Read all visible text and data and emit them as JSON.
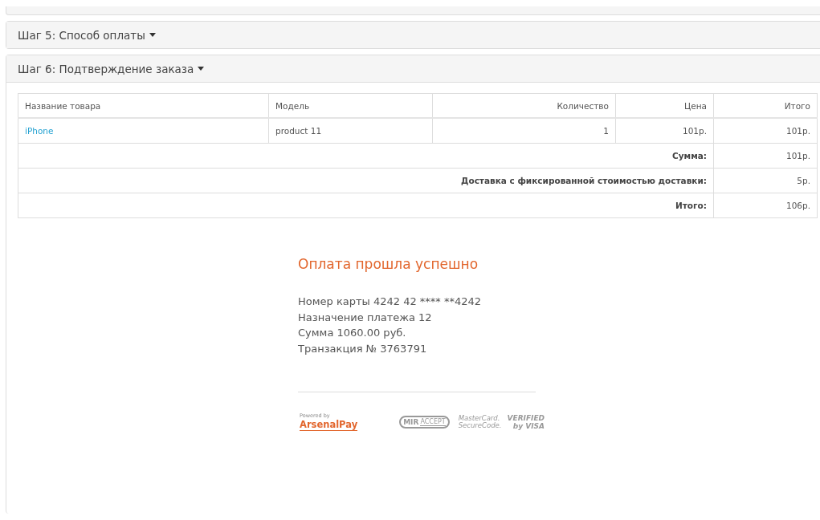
{
  "panels": [
    {
      "title": "Шаг 5: Способ оплаты",
      "expanded": false
    },
    {
      "title": "Шаг 6: Подтверждение заказа",
      "expanded": true
    }
  ],
  "table": {
    "columns": [
      "Название товара",
      "Модель",
      "Количество",
      "Цена",
      "Итого"
    ],
    "rows": [
      {
        "name": "iPhone",
        "model": "product 11",
        "quantity": "1",
        "price": "101р.",
        "total": "101р."
      }
    ],
    "totals": [
      {
        "label": "Сумма:",
        "value": "101р."
      },
      {
        "label": "Доставка с фиксированной стоимостью доставки:",
        "value": "5р."
      },
      {
        "label": "Итого:",
        "value": "106р."
      }
    ]
  },
  "payment": {
    "title": "Оплата прошла успешно",
    "lines": [
      "Номер карты 4242 42 **** **4242",
      "Назначение платежа 12",
      "Сумма 1060.00 руб.",
      "Транзакция № 3763791"
    ],
    "powered_by": "Powered by",
    "brand": "ArsenalPay",
    "mir": [
      "MIR",
      "ACCEPT"
    ],
    "mastercard": [
      "MasterCard.",
      "SecureCode."
    ],
    "visa": [
      "VERIFIED",
      "by VISA"
    ]
  }
}
